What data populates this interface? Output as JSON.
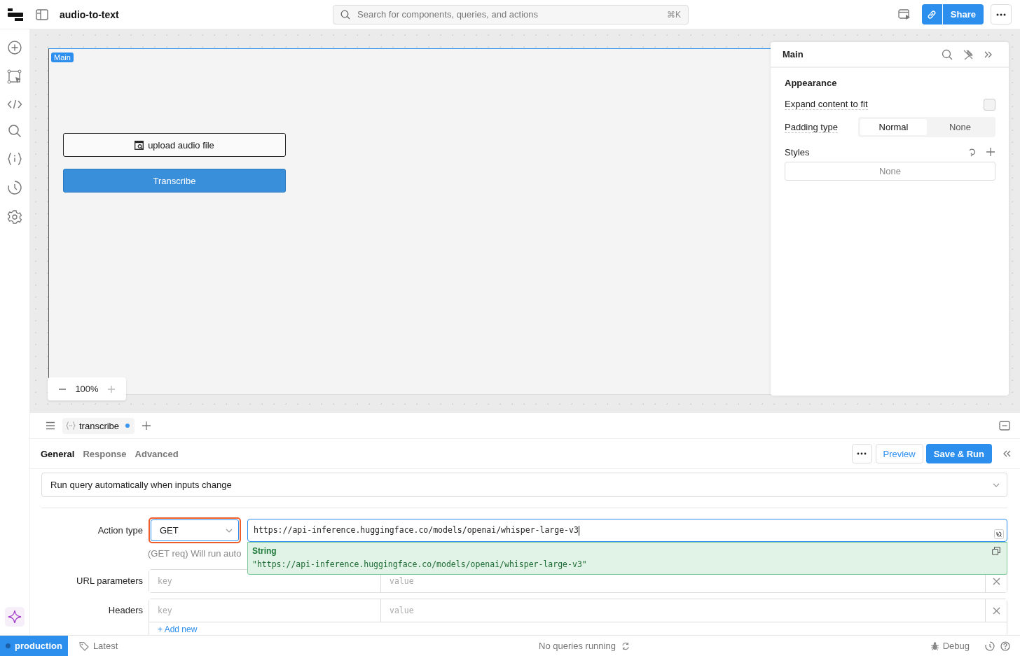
{
  "app": {
    "title": "audio-to-text",
    "search_placeholder": "Search for components, queries, and actions",
    "shortcut": "⌘K",
    "share_label": "Share"
  },
  "canvas": {
    "frame_label": "Main",
    "zoom": "100%",
    "buttons": [
      {
        "kind": "outline",
        "label": "upload audio file"
      },
      {
        "kind": "primary",
        "label": "Transcribe"
      }
    ]
  },
  "inspector": {
    "title": "Main",
    "section": "Appearance",
    "expand_label": "Expand content to fit",
    "expand_checked": false,
    "padding_label": "Padding type",
    "padding_options": [
      {
        "label": "Normal",
        "selected": true
      },
      {
        "label": "None",
        "selected": false
      }
    ],
    "styles_label": "Styles",
    "styles_value": "None"
  },
  "query": {
    "name": "transcribe",
    "unsaved": true,
    "tabs": [
      {
        "label": "General",
        "selected": true
      },
      {
        "label": "Response",
        "selected": false
      },
      {
        "label": "Advanced",
        "selected": false
      }
    ],
    "preview": "Preview",
    "save_run": "Save & Run",
    "trigger": "Run query automatically when inputs change",
    "action_label": "Action type",
    "method": "GET",
    "url": "https://api-inference.huggingface.co/models/openai/whisper-large-v3",
    "hint": "(GET req) Will run auto",
    "popup": {
      "type": "String",
      "value": "\"https://api-inference.huggingface.co/models/openai/whisper-large-v3\""
    },
    "kv_sections": [
      {
        "label": "URL parameters",
        "key_placeholder": "key",
        "value_placeholder": "value"
      },
      {
        "label": "Headers",
        "key_placeholder": "key",
        "value_placeholder": "value",
        "add_row": "+ Add new"
      }
    ]
  },
  "status": {
    "environment": "production",
    "version": "Latest",
    "queries": "No queries running",
    "debug": "Debug"
  }
}
